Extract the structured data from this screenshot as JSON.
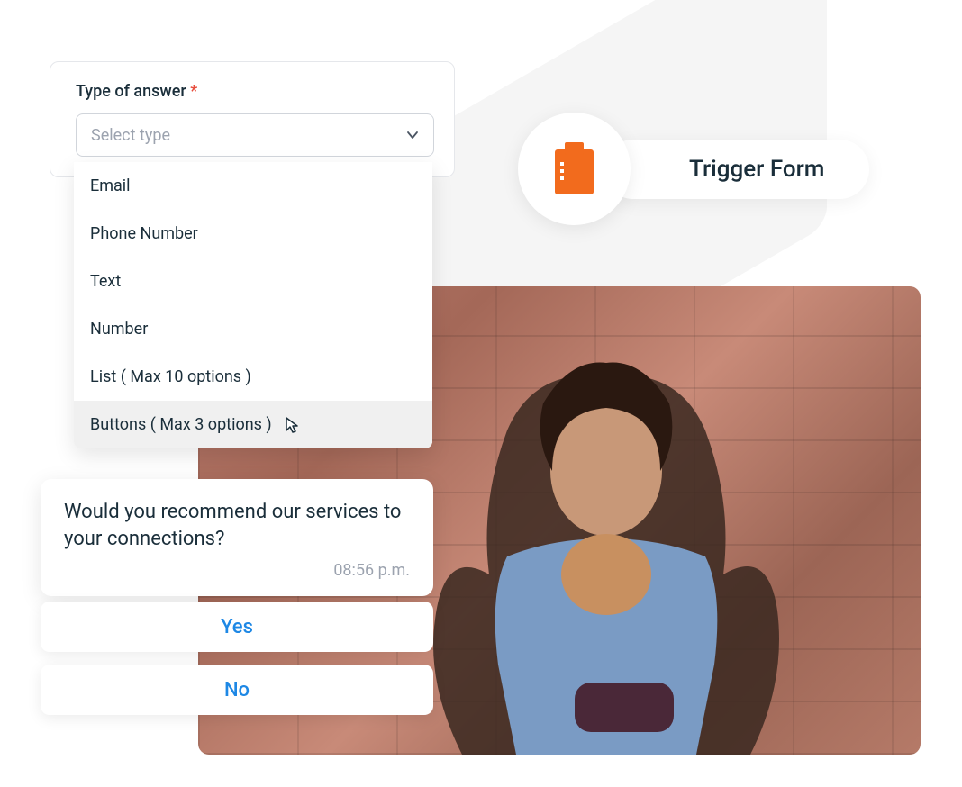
{
  "trigger": {
    "title": "Trigger Form",
    "icon": "clipboard-icon"
  },
  "dropdown": {
    "label": "Type of answer",
    "required_marker": "*",
    "placeholder": "Select type",
    "options": [
      {
        "label": "Email"
      },
      {
        "label": "Phone Number"
      },
      {
        "label": "Text"
      },
      {
        "label": "Number"
      },
      {
        "label": "List ( Max 10 options )"
      },
      {
        "label": "Buttons ( Max 3 options )",
        "hovered": true
      }
    ]
  },
  "chat": {
    "message": "Would you recommend our services to your connections?",
    "timestamp": "08:56 p.m.",
    "responses": [
      {
        "label": "Yes"
      },
      {
        "label": "No"
      }
    ]
  },
  "colors": {
    "accent_orange": "#f26b1d",
    "primary_blue": "#1e88e5",
    "text_dark": "#1a2e3a",
    "text_muted": "#9ca3af"
  }
}
